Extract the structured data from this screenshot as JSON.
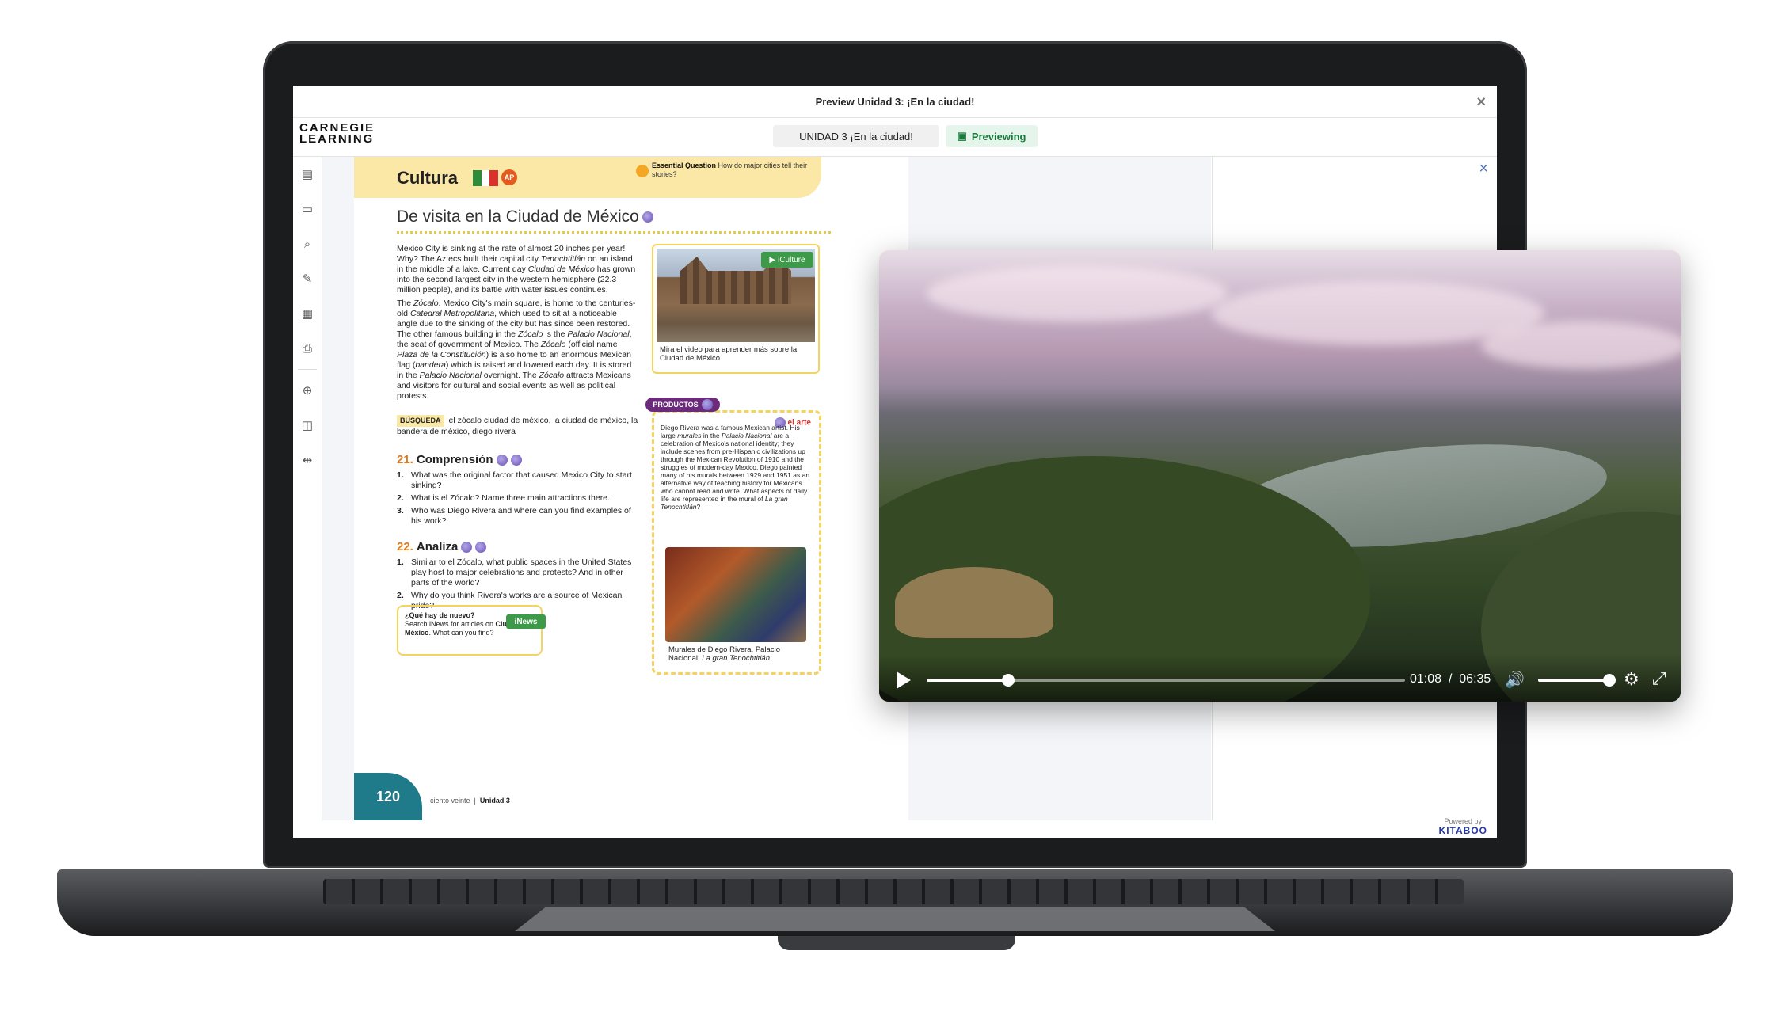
{
  "window": {
    "title": "Preview Unidad 3: ¡En la ciudad!",
    "close_icon": "×"
  },
  "toolbar": {
    "logo_line1": "CARNEGIE",
    "logo_line2": "LEARNING",
    "unit_label": "UNIDAD 3 ¡En la ciudad!",
    "preview_label": "Previewing"
  },
  "sidebar": {
    "icons": [
      "document-icon",
      "notes-icon",
      "search-text-icon",
      "pen-icon",
      "grid-icon",
      "print-icon",
      "zoom-in-icon",
      "book-view-icon",
      "fit-width-icon"
    ]
  },
  "footer": {
    "powered_by": "Powered by",
    "brand": "KITABOO"
  },
  "page": {
    "section_title": "Cultura",
    "ap_badge": "AP",
    "essential_question_label": "Essential Question",
    "essential_question": "How do major cities tell their stories?",
    "heading": "De visita en la Ciudad de México",
    "paragraph1_parts": [
      "Mexico City is sinking at the rate of almost 20 inches per year! Why? The Aztecs built their capital city ",
      "Tenochtitlán",
      " on an island in the middle of a lake. Current day ",
      "Ciudad de México",
      " has grown into the second largest city in the western hemisphere (22.3 million people), and its battle with water issues continues."
    ],
    "paragraph2_parts": [
      "The ",
      "Zócalo",
      ", Mexico City's main square, is home to the centuries-old ",
      "Catedral Metropolitana",
      ", which used to sit at a noticeable angle due to the sinking of the city but has since been restored. The other famous building in the ",
      "Zócalo",
      " is the ",
      "Palacio Nacional",
      ", the seat of government of Mexico. The ",
      "Zócalo",
      " (official name ",
      "Plaza de la Constitución",
      ") is also home to an enormous Mexican flag (",
      "bandera",
      ") which is raised and lowered each day. It is stored in the ",
      "Palacio Nacional",
      " overnight. The ",
      "Zócalo",
      " attracts Mexicans and visitors for cultural and social events as well as political protests."
    ],
    "busqueda_label": "BÚSQUEDA",
    "busqueda_text": "el zócalo ciudad de méxico, la ciudad de méxico, la bandera de méxico, diego rivera",
    "sec21_num": "21.",
    "sec21_title": "Comprensión",
    "sec21_questions": [
      {
        "n": "1.",
        "text": "What was the original factor that caused Mexico City to start sinking?"
      },
      {
        "n": "2.",
        "text": "What is el Zócalo? Name three main attractions there."
      },
      {
        "n": "3.",
        "text": "Who was Diego Rivera and where can you find examples of his work?"
      }
    ],
    "sec22_num": "22.",
    "sec22_title": "Analiza",
    "sec22_questions": [
      {
        "n": "1.",
        "text": "Similar to el Zócalo, what public spaces in the United States play host to major celebrations and protests? And in other parts of the world?"
      },
      {
        "n": "2.",
        "text": "Why do you think Rivera's works are a source of Mexican pride?"
      }
    ],
    "news_title": "¿Qué hay de nuevo?",
    "news_text_parts": [
      "Search iNews for articles on ",
      "Ciudad de México",
      ". What can you find?"
    ],
    "news_tag": "iNews",
    "culture_tag": "iCulture",
    "photo_caption": "Mira el video para aprender más sobre la Ciudad de México.",
    "productos_tag": "PRODUCTOS",
    "arte_tag": "el arte",
    "arte_text_parts": [
      "Diego Rivera was a famous Mexican artist. His large ",
      "murales",
      " in the ",
      "Palacio Nacional",
      " are a celebration of Mexico's national identity; they include scenes from pre-Hispanic civilizations up through the Mexican Revolution of 1910 and the struggles of modern-day Mexico. Diego painted many of his murals between 1929 and 1951 as an alternative way of teaching history for Mexicans who cannot read and write. What aspects of daily life are represented in the mural of ",
      "La gran Tenochtitlán",
      "?"
    ],
    "mural_caption_parts": [
      "Murales de Diego Rivera, Palacio Nacional: ",
      "La gran Tenochtitlán"
    ],
    "page_number": "120",
    "footer_text": "ciento veinte",
    "footer_unit": "Unidad 3"
  },
  "video": {
    "current_time": "01:08",
    "separator": "/",
    "duration": "06:35",
    "progress_fraction": 0.17,
    "volume_fraction": 1.0,
    "icons": {
      "play": "play-icon",
      "volume": "volume-icon",
      "settings": "gear-icon",
      "fullscreen": "fullscreen-icon"
    }
  },
  "colors": {
    "accent_green": "#197a3c",
    "page_number_bg": "#1f7b8a",
    "cultura_band": "#fbe7a6",
    "productos_purple": "#6b2b7a",
    "kitaboo_blue": "#2436a8"
  }
}
